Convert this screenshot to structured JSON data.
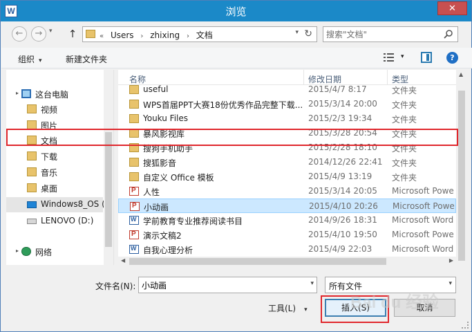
{
  "window": {
    "title": "浏览",
    "app_icon_letter": "W",
    "close_label": "✕"
  },
  "nav": {
    "back_icon": "←",
    "forward_icon": "→",
    "dropdown_icon": "▾",
    "up_icon": "↑"
  },
  "address": {
    "overflow_marker": "«",
    "crumbs": [
      "Users",
      "zhixing",
      "文档"
    ],
    "separator": "›",
    "refresh_icon": "↻"
  },
  "search": {
    "placeholder": "搜索\"文档\""
  },
  "toolbar": {
    "organize_label": "组织",
    "new_folder_label": "新建文件夹",
    "help_label": "?"
  },
  "sidebar": {
    "items": [
      {
        "label": "这台电脑",
        "icon": "computer-icon"
      },
      {
        "label": "视频",
        "icon": "folder-icon"
      },
      {
        "label": "图片",
        "icon": "folder-icon"
      },
      {
        "label": "文档",
        "icon": "folder-icon"
      },
      {
        "label": "下载",
        "icon": "folder-icon"
      },
      {
        "label": "音乐",
        "icon": "folder-icon"
      },
      {
        "label": "桌面",
        "icon": "folder-icon"
      },
      {
        "label": "Windows8_OS (",
        "icon": "windows-drive-icon"
      },
      {
        "label": "LENOVO (D:)",
        "icon": "drive-icon"
      },
      {
        "label": "网络",
        "icon": "network-icon"
      }
    ]
  },
  "filelist": {
    "columns": {
      "name": "名称",
      "date": "修改日期",
      "type": "类型"
    },
    "rows": [
      {
        "name": "useful",
        "date": "2015/4/7 8:17",
        "type": "文件夹",
        "icon": "folder-icon"
      },
      {
        "name": "WPS首届PPT大赛18份优秀作品完整下载...",
        "date": "2015/3/14 20:00",
        "type": "文件夹",
        "icon": "folder-icon"
      },
      {
        "name": "Youku Files",
        "date": "2015/2/3 19:34",
        "type": "文件夹",
        "icon": "folder-icon"
      },
      {
        "name": "暴风影视库",
        "date": "2015/3/28 20:54",
        "type": "文件夹",
        "icon": "folder-icon"
      },
      {
        "name": "搜狗手机助手",
        "date": "2015/2/28 18:10",
        "type": "文件夹",
        "icon": "folder-icon"
      },
      {
        "name": "搜狐影音",
        "date": "2014/12/26 22:41",
        "type": "文件夹",
        "icon": "folder-icon"
      },
      {
        "name": "自定义 Office 模板",
        "date": "2015/4/9 13:19",
        "type": "文件夹",
        "icon": "folder-icon"
      },
      {
        "name": "人性",
        "date": "2015/3/14 20:05",
        "type": "Microsoft Powe",
        "icon": "powerpoint-icon"
      },
      {
        "name": "小动画",
        "date": "2015/4/10 20:26",
        "type": "Microsoft Powe",
        "icon": "powerpoint-icon",
        "selected": true
      },
      {
        "name": "学前教育专业推荐阅读书目",
        "date": "2014/9/26 18:31",
        "type": "Microsoft Word",
        "icon": "word-icon"
      },
      {
        "name": "演示文稿2",
        "date": "2015/4/10 19:50",
        "type": "Microsoft Powe",
        "icon": "powerpoint-icon"
      },
      {
        "name": "自我心理分析",
        "date": "2015/4/9 22:03",
        "type": "Microsoft Word",
        "icon": "word-icon"
      }
    ]
  },
  "bottom": {
    "filename_label": "文件名(N):",
    "filename_value": "小动画",
    "filetype_value": "所有文件",
    "tools_label": "工具(L)",
    "insert_label": "插入(S)",
    "cancel_label": "取消"
  },
  "watermark": "Bai du 经验",
  "colors": {
    "titlebar": "#1b89c8",
    "selection": "#cce8ff",
    "highlight_annotation": "#e0262b"
  }
}
